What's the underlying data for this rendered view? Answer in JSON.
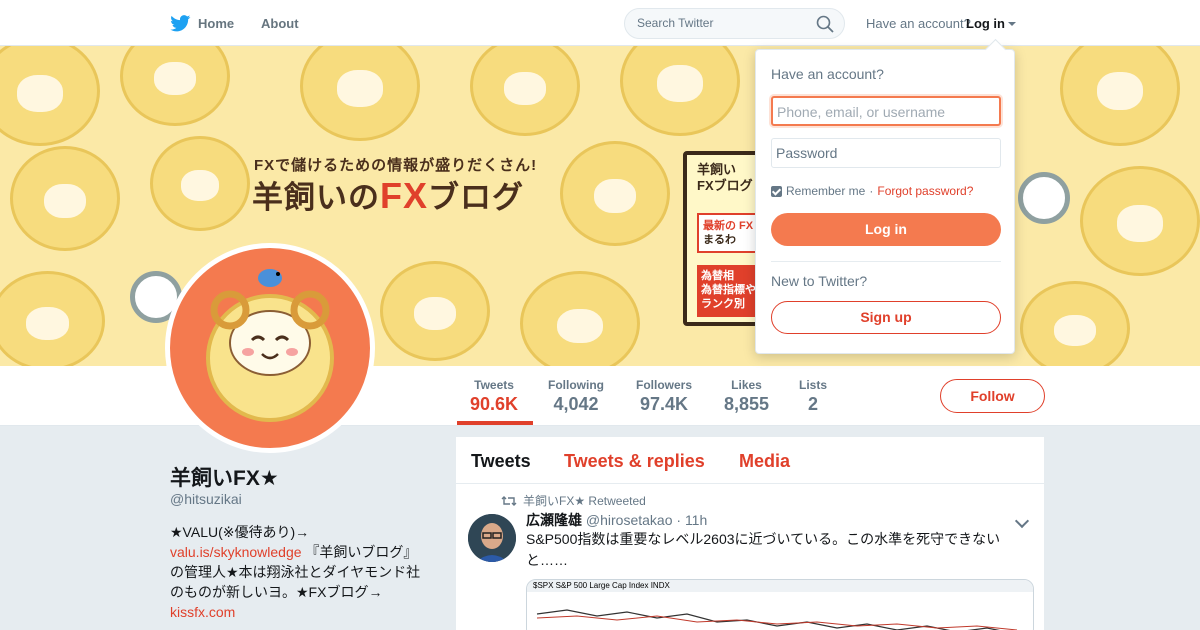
{
  "nav": {
    "home_label": "Home",
    "about_label": "About",
    "search_placeholder": "Search Twitter",
    "account_question": "Have an account?",
    "login_label": "Log in"
  },
  "banner": {
    "tagline": "FXで儲けるための情報が盛りだくさん!",
    "title_pre": "羊飼いの",
    "title_fx": "FX",
    "title_post": "ブログ",
    "board_line1": "羊飼い",
    "board_line2": "FXブログ",
    "board_box1_a": "最新の FX",
    "board_box1_b": "まるわ",
    "board_box2_a": "為替相",
    "board_box2_b": "為替指標や",
    "board_box2_c": "ランク別"
  },
  "profile": {
    "name": "羊飼いFX★",
    "handle": "@hitsuzikai",
    "bio_line1": "★VALU(※優待あり)→",
    "bio_link1": "valu.is/skyknowledge",
    "bio_text2": " 『羊飼いブログ』の管理人★本は翔泳社とダイヤモンド社のものが新しいヨ。★FXブログ→",
    "bio_link2": "kissfx.com",
    "stats": [
      {
        "label": "Tweets",
        "value": "90.6K"
      },
      {
        "label": "Following",
        "value": "4,042"
      },
      {
        "label": "Followers",
        "value": "97.4K"
      },
      {
        "label": "Likes",
        "value": "8,855"
      },
      {
        "label": "Lists",
        "value": "2"
      }
    ],
    "follow_label": "Follow"
  },
  "timeline": {
    "tabs": [
      "Tweets",
      "Tweets & replies",
      "Media"
    ],
    "retweet_note": "羊飼いFX★ Retweeted",
    "tweet": {
      "name": "広瀬隆雄",
      "handle": "@hirosetakao",
      "time": "11h",
      "text": "S&P500指数は重要なレベル2603に近づいている。この水準を死守できないと……",
      "media_caption": "$SPX S&P 500 Large Cap Index INDX"
    }
  },
  "login_box": {
    "question": "Have an account?",
    "username_placeholder": "Phone, email, or username",
    "password_placeholder": "Password",
    "remember_label": "Remember me",
    "separator": " · ",
    "forgot_label": "Forgot password?",
    "login_button": "Log in",
    "new_question": "New to Twitter?",
    "signup_button": "Sign up"
  },
  "colors": {
    "accent": "#e0402b",
    "login_button": "#f47a4f",
    "twitter_blue": "#1da1f2",
    "banner_bg": "#fbe9a7"
  }
}
